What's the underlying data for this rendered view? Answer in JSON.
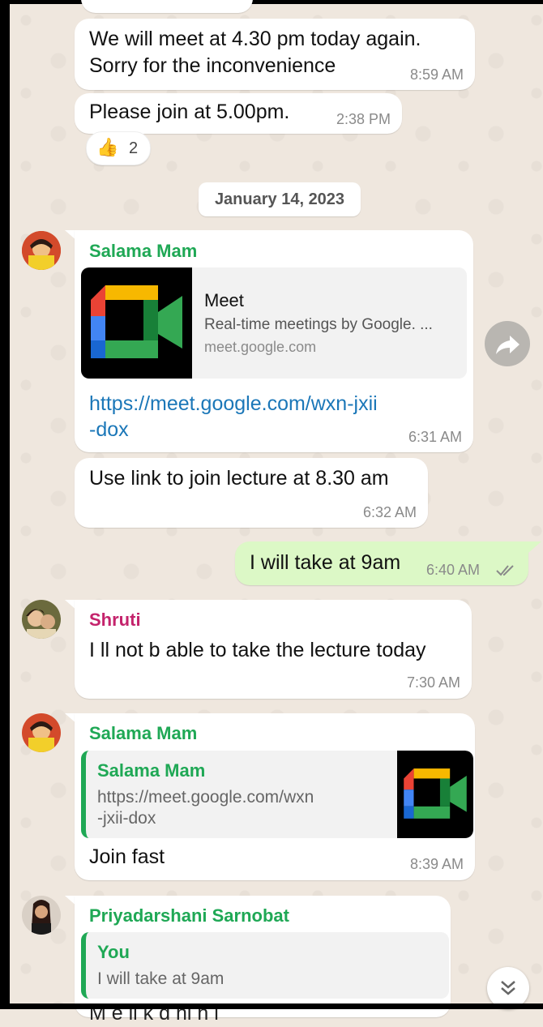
{
  "messages": {
    "m1_line1": "We will meet at 4.30 pm today again.",
    "m1_line2": "Sorry for the inconvenience",
    "m1_time": "8:59 AM",
    "m2_text": "Please join at 5.00pm.",
    "m2_time": "2:38 PM",
    "m2_reaction_emoji": "👍",
    "m2_reaction_count": "2",
    "date_chip": "January 14, 2023",
    "m3_sender": "Salama Mam",
    "m3_preview_title": "Meet",
    "m3_preview_desc": "Real-time meetings by Google. ...",
    "m3_preview_domain": "meet.google.com",
    "m3_link_line1": "https://meet.google.com/wxn-jxii",
    "m3_link_line2": "-dox",
    "m3_time": "6:31 AM",
    "m4_text": "Use link to join lecture at 8.30 am",
    "m4_time": "6:32 AM",
    "m5_text": "I will take at 9am",
    "m5_time": "6:40 AM",
    "m6_sender": "Shruti",
    "m6_text": "I ll not b able to take the lecture today",
    "m6_time": "7:30 AM",
    "m7_sender": "Salama Mam",
    "m7_quote_author": "Salama Mam",
    "m7_quote_line1": "https://meet.google.com/wxn",
    "m7_quote_line2": "-jxii-dox",
    "m7_text": "Join fast",
    "m7_time": "8:39 AM",
    "m8_sender": "Priyadarshani Sarnobat",
    "m8_quote_author": "You",
    "m8_quote_text": "I will take at 9am",
    "m8_partial_text": "M    e       li   k      d        hi   h   l"
  },
  "icons": {
    "forward": "share-forward-icon",
    "scroll_down": "double-chevron-down-icon",
    "read_receipt": "double-check-icon"
  },
  "colors": {
    "wallpaper": "#efe7de",
    "incoming_bubble": "#ffffff",
    "outgoing_bubble": "#dcf8c6",
    "sender_green": "#1fa855",
    "sender_pink": "#c4236c",
    "link_blue": "#1b77b8"
  }
}
